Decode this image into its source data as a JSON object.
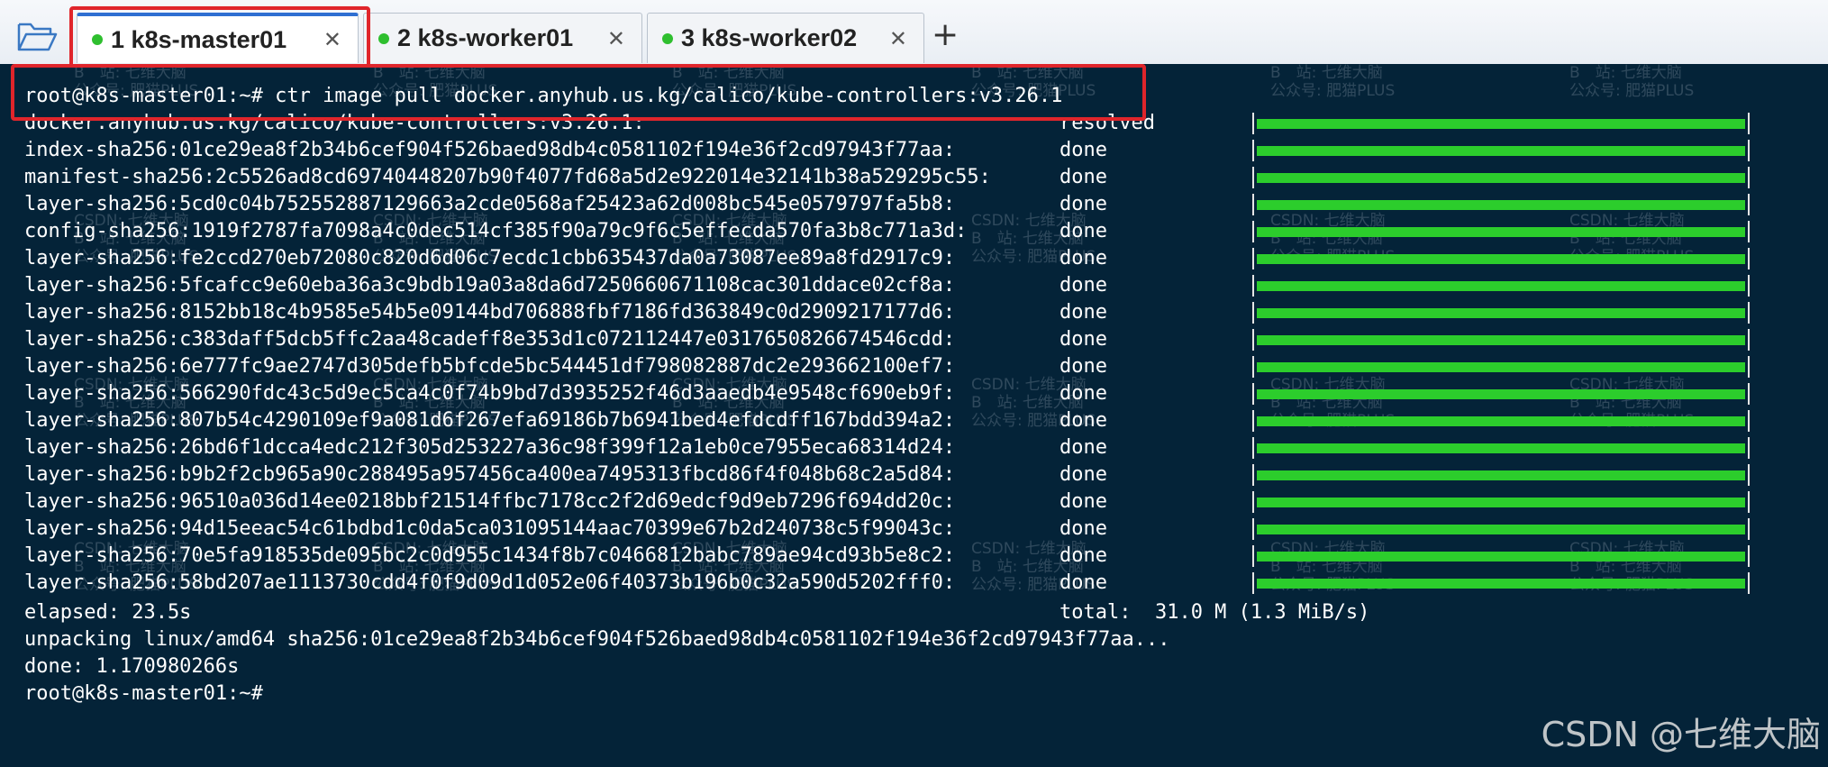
{
  "tabs": [
    {
      "number": "1",
      "name": "k8s-master01",
      "active": true,
      "status_color": "#2fbf2f",
      "close_icon": "✕"
    },
    {
      "number": "2",
      "name": "k8s-worker01",
      "active": false,
      "status_color": "#2fbf2f",
      "close_icon": "✕"
    },
    {
      "number": "3",
      "name": "k8s-worker02",
      "active": false,
      "status_color": "#2fbf2f",
      "close_icon": "✕"
    }
  ],
  "add_tab_icon": "+",
  "folder_icon": "folder-open-icon",
  "terminal": {
    "command_line": "root@k8s-master01:~# ctr image pull docker.anyhub.us.kg/calico/kube-controllers:v3.26.1",
    "progress_rows": [
      {
        "ref": "docker.anyhub.us.kg/calico/kube-controllers:v3.26.1:",
        "status": "resolved",
        "progress": 1.0
      },
      {
        "ref": "index-sha256:01ce29ea8f2b34b6cef904f526baed98db4c0581102f194e36f2cd97943f77aa:",
        "status": "done",
        "progress": 1.0
      },
      {
        "ref": "manifest-sha256:2c5526ad8cd69740448207b90f4077fd68a5d2e922014e32141b38a529295c55:",
        "status": "done",
        "progress": 1.0
      },
      {
        "ref": "layer-sha256:5cd0c04b752552887129663a2cde0568af25423a62d008bc545e0579797fa5b8:",
        "status": "done",
        "progress": 1.0
      },
      {
        "ref": "config-sha256:1919f2787fa7098a4c0dec514cf385f90a79c9f6c5effecda570fa3b8c771a3d:",
        "status": "done",
        "progress": 1.0
      },
      {
        "ref": "layer-sha256:fe2ccd270eb72080c820d6d06c7ecdc1cbb635437da0a73087ee89a8fd2917c9:",
        "status": "done",
        "progress": 1.0
      },
      {
        "ref": "layer-sha256:5fcafcc9e60eba36a3c9bdb19a03a8da6d7250660671108cac301ddace02cf8a:",
        "status": "done",
        "progress": 1.0
      },
      {
        "ref": "layer-sha256:8152bb18c4b9585e54b5e09144bd706888fbf7186fd363849c0d2909217177d6:",
        "status": "done",
        "progress": 1.0
      },
      {
        "ref": "layer-sha256:c383daff5dcb5ffc2aa48cadeff8e353d1c072112447e0317650826674546cdd:",
        "status": "done",
        "progress": 1.0
      },
      {
        "ref": "layer-sha256:6e777fc9ae2747d305defb5bfcde5bc544451df798082887dc2e293662100ef7:",
        "status": "done",
        "progress": 1.0
      },
      {
        "ref": "layer-sha256:566290fdc43c5d9ec5ca4c0f74b9bd7d3935252f46d3aaedb4e9548cf690eb9f:",
        "status": "done",
        "progress": 1.0
      },
      {
        "ref": "layer-sha256:807b54c4290109ef9a081d6f267efa69186b7b6941bed4efdcdff167bdd394a2:",
        "status": "done",
        "progress": 1.0
      },
      {
        "ref": "layer-sha256:26bd6f1dcca4edc212f305d253227a36c98f399f12a1eb0ce7955eca68314d24:",
        "status": "done",
        "progress": 1.0
      },
      {
        "ref": "layer-sha256:b9b2f2cb965a90c288495a957456ca400ea7495313fbcd86f4f048b68c2a5d84:",
        "status": "done",
        "progress": 1.0
      },
      {
        "ref": "layer-sha256:96510a036d14ee0218bbf21514ffbc7178cc2f2d69edcf9d9eb7296f694dd20c:",
        "status": "done",
        "progress": 1.0
      },
      {
        "ref": "layer-sha256:94d15eeac54c61bdbd1c0da5ca031095144aac70399e67b2d240738c5f99043c:",
        "status": "done",
        "progress": 1.0
      },
      {
        "ref": "layer-sha256:70e5fa918535de095bc2c0d955c1434f8b7c0466812babc789ae94cd93b5e8c2:",
        "status": "done",
        "progress": 1.0
      },
      {
        "ref": "layer-sha256:58bd207ae1113730cdd4f0f9d09d1d052e06f40373b196b0c32a590d5202fff0:",
        "status": "done",
        "progress": 1.0
      }
    ],
    "elapsed_line": "elapsed: 23.5s",
    "total_line": "total:  31.0 M (1.3 MiB/s)",
    "unpacking_line": "unpacking linux/amd64 sha256:01ce29ea8f2b34b6cef904f526baed98db4c0581102f194e36f2cd97943f77aa...",
    "done_line": "done: 1.170980266s",
    "prompt_line": "root@k8s-master01:~#"
  },
  "watermarks": {
    "tile_lines": [
      "CSDN: 七维大脑",
      "B　站: 七维大脑",
      "公众号: 肥猫PLUS"
    ],
    "brand": "CSDN @七维大脑"
  },
  "colors": {
    "terminal_bg": "#042338",
    "terminal_fg": "#ffffff",
    "progress_green": "#2ccd2c",
    "active_tab_accent": "#2e6fd2",
    "highlight_red": "#e0252b"
  }
}
